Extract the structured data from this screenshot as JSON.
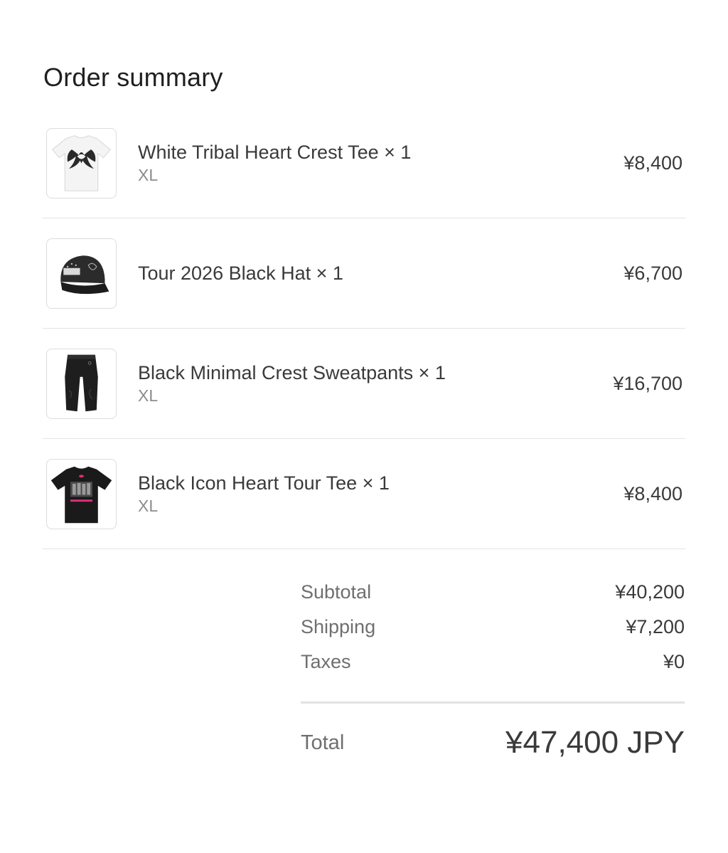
{
  "header": {
    "title": "Order summary"
  },
  "items": [
    {
      "name": "White Tribal Heart Crest Tee × 1",
      "variant": "XL",
      "price": "¥8,400",
      "thumbnail_icon": "white-tee-icon"
    },
    {
      "name": "Tour 2026 Black Hat × 1",
      "variant": "",
      "price": "¥6,700",
      "thumbnail_icon": "black-hat-icon"
    },
    {
      "name": "Black Minimal Crest Sweatpants × 1",
      "variant": "XL",
      "price": "¥16,700",
      "thumbnail_icon": "black-sweatpants-icon"
    },
    {
      "name": "Black Icon Heart Tour Tee × 1",
      "variant": "XL",
      "price": "¥8,400",
      "thumbnail_icon": "black-tee-icon"
    }
  ],
  "totals": {
    "subtotal_label": "Subtotal",
    "subtotal_value": "¥40,200",
    "shipping_label": "Shipping",
    "shipping_value": "¥7,200",
    "taxes_label": "Taxes",
    "taxes_value": "¥0",
    "total_label": "Total",
    "total_value": "¥47,400 JPY"
  },
  "colors": {
    "text_primary": "#3a3a3a",
    "text_secondary": "#8c8c8c",
    "divider": "#e3e3e3",
    "accent_pink": "#e0307a"
  }
}
